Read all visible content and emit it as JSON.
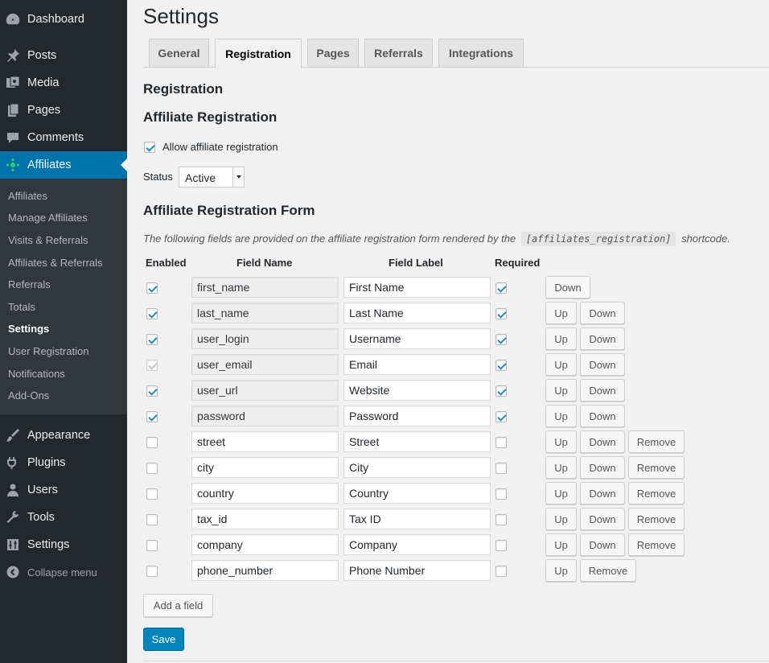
{
  "sidebar": {
    "top_items": [
      {
        "label": "Dashboard",
        "icon": "dashboard-icon"
      },
      {
        "label": "Posts",
        "icon": "pushpin-icon"
      },
      {
        "label": "Media",
        "icon": "media-icon"
      },
      {
        "label": "Pages",
        "icon": "pages-icon"
      },
      {
        "label": "Comments",
        "icon": "comment-icon"
      },
      {
        "label": "Affiliates",
        "icon": "affiliates-icon"
      }
    ],
    "submenu": [
      "Affiliates",
      "Manage Affiliates",
      "Visits & Referrals",
      "Affiliates & Referrals",
      "Referrals",
      "Totals",
      "Settings",
      "User Registration",
      "Notifications",
      "Add-Ons"
    ],
    "bottom_items": [
      {
        "label": "Appearance",
        "icon": "paintbrush-icon"
      },
      {
        "label": "Plugins",
        "icon": "plugins-icon"
      },
      {
        "label": "Users",
        "icon": "users-icon"
      },
      {
        "label": "Tools",
        "icon": "wrench-icon"
      },
      {
        "label": "Settings",
        "icon": "settings-icon"
      }
    ],
    "collapse_label": "Collapse menu",
    "active_color": "#0073aa"
  },
  "page": {
    "title": "Settings",
    "tabs": [
      "General",
      "Registration",
      "Pages",
      "Referrals",
      "Integrations"
    ],
    "active_tab": "Registration",
    "section_title": "Registration",
    "affiliate_registration_title": "Affiliate Registration",
    "allow_label": "Allow affiliate registration",
    "status_label": "Status",
    "status_value": "Active",
    "form_title": "Affiliate Registration Form",
    "desc_before": "The following fields are provided on the affiliate registration form rendered by the",
    "desc_code": "[affiliates_registration]",
    "desc_after": "shortcode."
  },
  "table": {
    "headers": [
      "Enabled",
      "Field Name",
      "Field Label",
      "Required"
    ],
    "up_label": "Up",
    "down_label": "Down",
    "remove_label": "Remove",
    "rows": [
      {
        "enabled": true,
        "disabled": false,
        "name": "first_name",
        "label": "First Name",
        "required": true,
        "readonly": true,
        "up": false,
        "down": true,
        "remove": false
      },
      {
        "enabled": true,
        "disabled": false,
        "name": "last_name",
        "label": "Last Name",
        "required": true,
        "readonly": true,
        "up": true,
        "down": true,
        "remove": false
      },
      {
        "enabled": true,
        "disabled": false,
        "name": "user_login",
        "label": "Username",
        "required": true,
        "readonly": true,
        "up": true,
        "down": true,
        "remove": false
      },
      {
        "enabled": true,
        "disabled": true,
        "name": "user_email",
        "label": "Email",
        "required": true,
        "readonly": true,
        "up": true,
        "down": true,
        "remove": false
      },
      {
        "enabled": true,
        "disabled": false,
        "name": "user_url",
        "label": "Website",
        "required": true,
        "readonly": true,
        "up": true,
        "down": true,
        "remove": false
      },
      {
        "enabled": true,
        "disabled": false,
        "name": "password",
        "label": "Password",
        "required": true,
        "readonly": true,
        "up": true,
        "down": true,
        "remove": false
      },
      {
        "enabled": false,
        "disabled": false,
        "name": "street",
        "label": "Street",
        "required": false,
        "readonly": false,
        "up": true,
        "down": true,
        "remove": true
      },
      {
        "enabled": false,
        "disabled": false,
        "name": "city",
        "label": "City",
        "required": false,
        "readonly": false,
        "up": true,
        "down": true,
        "remove": true
      },
      {
        "enabled": false,
        "disabled": false,
        "name": "country",
        "label": "Country",
        "required": false,
        "readonly": false,
        "up": true,
        "down": true,
        "remove": true
      },
      {
        "enabled": false,
        "disabled": false,
        "name": "tax_id",
        "label": "Tax ID",
        "required": false,
        "readonly": false,
        "up": true,
        "down": true,
        "remove": true
      },
      {
        "enabled": false,
        "disabled": false,
        "name": "company",
        "label": "Company",
        "required": false,
        "readonly": false,
        "up": true,
        "down": true,
        "remove": true
      },
      {
        "enabled": false,
        "disabled": false,
        "name": "phone_number",
        "label": "Phone Number",
        "required": false,
        "readonly": false,
        "up": true,
        "down": false,
        "remove": true
      }
    ]
  },
  "actions": {
    "add_field_label": "Add a field",
    "save_label": "Save",
    "save_color": "#0085ba"
  }
}
